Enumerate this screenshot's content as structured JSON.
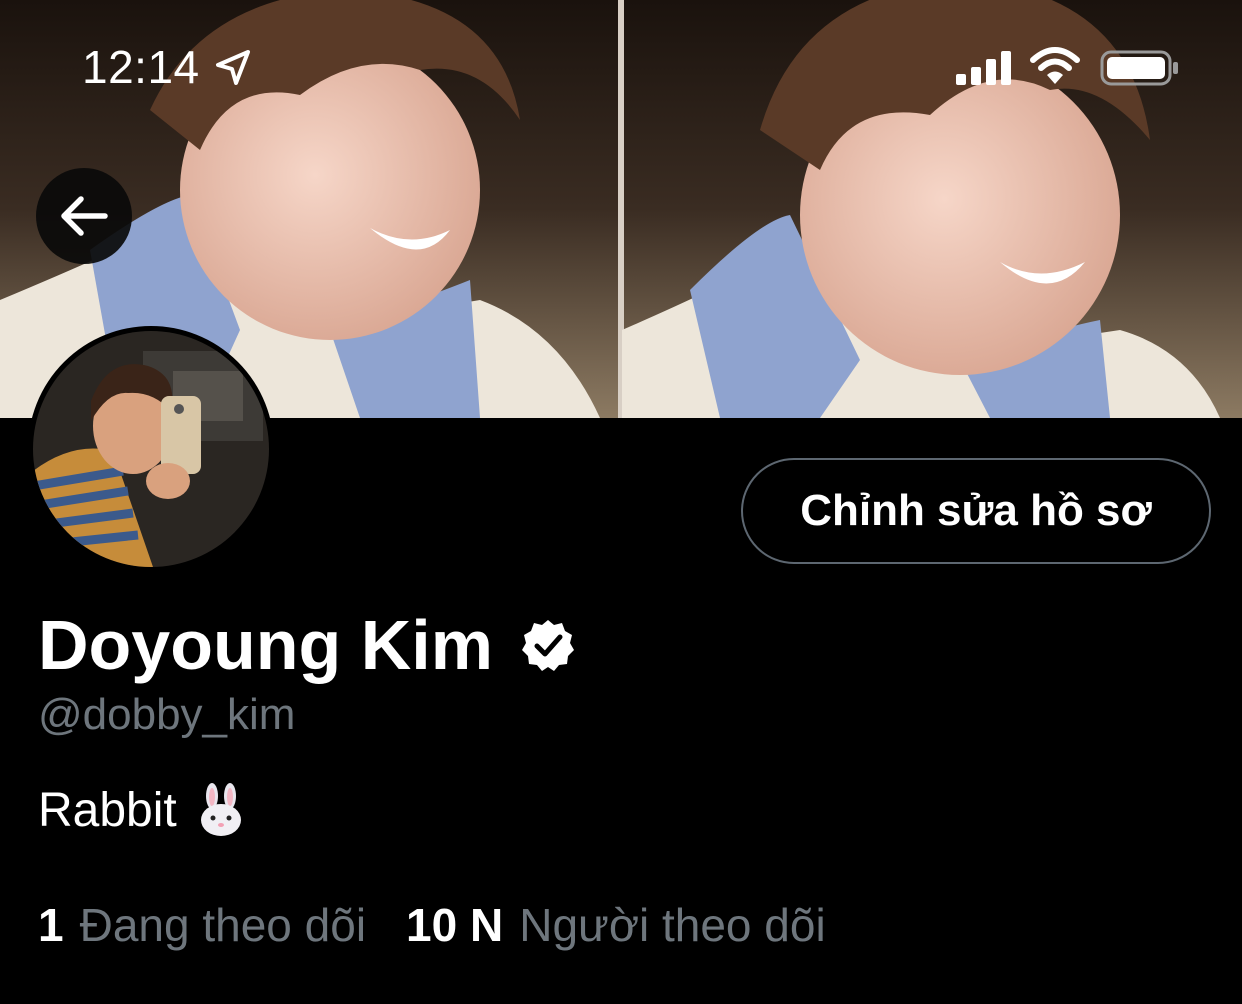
{
  "status_bar": {
    "time": "12:14",
    "icons": [
      "location-arrow-icon",
      "cellular-signal-icon",
      "wifi-icon",
      "battery-icon"
    ]
  },
  "header": {
    "back_icon": "back-arrow-icon"
  },
  "profile": {
    "edit_button_label": "Chỉnh sửa hồ sơ",
    "display_name": "Doyoung Kim",
    "verified_icon": "verified-badge-icon",
    "handle": "@dobby_kim",
    "bio": "Rabbit",
    "bio_emoji": "rabbit-face-icon"
  },
  "stats": {
    "following_count": "1",
    "following_label": "Đang theo dõi",
    "followers_count": "10 N",
    "followers_label": "Người theo dõi"
  },
  "colors": {
    "background": "#000000",
    "text_primary": "#ffffff",
    "text_secondary": "#6e767d",
    "button_border": "#5d6771"
  }
}
